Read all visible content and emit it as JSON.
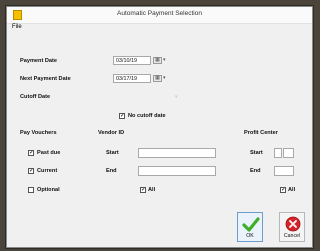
{
  "window": {
    "title": "Automatic Payment Selection"
  },
  "menu": {
    "file": "File"
  },
  "fields": {
    "payment_date": {
      "label": "Payment Date",
      "value": "03/10/19"
    },
    "next_payment_date": {
      "label": "Next Payment Date",
      "value": "03/17/19"
    },
    "cutoff_date": {
      "label": "Cutoff Date",
      "value": ""
    },
    "no_cutoff": {
      "label": "No cutoff date",
      "checked": true
    }
  },
  "columns": {
    "pay_vouchers": "Pay Vouchers",
    "vendor_id": "Vendor ID",
    "profit_center": "Profit Center"
  },
  "pay_vouchers": {
    "past_due": {
      "label": "Past due",
      "checked": true
    },
    "current": {
      "label": "Current",
      "checked": true
    },
    "optional": {
      "label": "Optional",
      "checked": false
    }
  },
  "vendor": {
    "start_label": "Start",
    "end_label": "End",
    "all_label": "All",
    "all_checked": true
  },
  "profit_center": {
    "start_label": "Start",
    "end_label": "End",
    "all_label": "All",
    "all_checked": true
  },
  "buttons": {
    "ok": "OK",
    "cancel": "Cancel"
  },
  "glyphs": {
    "check": "✓",
    "calendar": "▦",
    "dropdown": "▾"
  }
}
